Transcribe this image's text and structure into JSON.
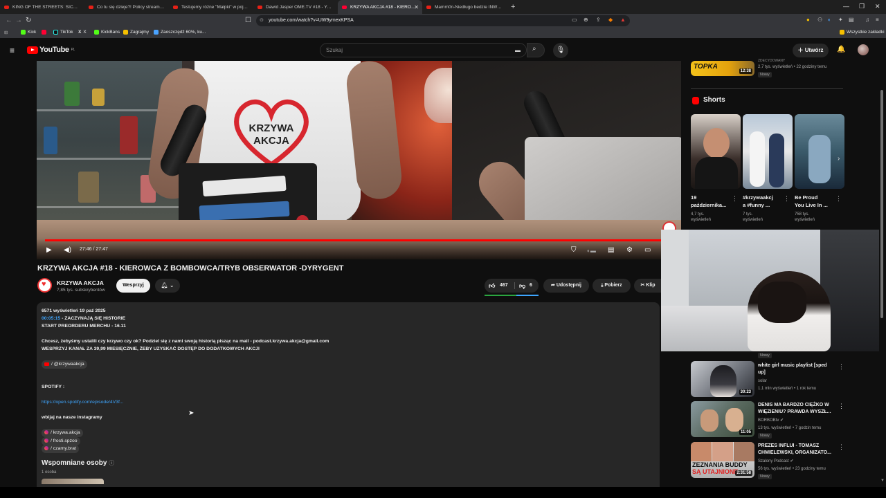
{
  "browser": {
    "tabs": [
      {
        "title": "KING OF THE STREETS: SICKO MODE"
      },
      {
        "title": "Co tu się dzieje?! Policy streamerzy -"
      },
      {
        "title": "Testujemy różne \"Małpki\" w pojedy..."
      },
      {
        "title": "Dawid Jasper OME.TV #18 - YouTube"
      },
      {
        "title": "KRZYWA AKCJA #18 - KIEROWC",
        "active": true
      },
      {
        "title": "Mamm0n-Niedługo bedzie INWIGIL..."
      }
    ],
    "url": "youtube.com/watch?v=UW9ymexKPSA",
    "bookmarks": [
      "Kick",
      "TikTok",
      "X",
      "KickBans",
      "Zagrajmy",
      "Zaoszczędź 60%, ku..."
    ],
    "all_bookmarks_label": "Wszystkie zakładki"
  },
  "yt_header": {
    "logo_text": "YouTube",
    "region": "PL",
    "search_placeholder": "Szukaj",
    "create_label": "Utwórz"
  },
  "player": {
    "time": "27:46 / 27:47",
    "progress_fraction": 0.999
  },
  "video": {
    "title": "KRZYWA AKCJA #18 - KIEROWCA Z BOMBOWCA/TRYB OBSERWATOR -DYRYGENT",
    "channel": "KRZYWA AKCJA",
    "subscribers": "7,85 tys. subskrybentów",
    "support_label": "Wesprzyj",
    "likes": "467",
    "dislikes": "6",
    "share_label": "Udostępnij",
    "download_label": "Pobierz",
    "clip_label": "Klip"
  },
  "description": {
    "stats": "6571 wyświetleń  19 paź 2025",
    "timestamp": "00:05:15",
    "line1_rest": " - ZACZYNAJĄ SIĘ HISTORIE",
    "line2": "START PREORDERU MERCHU - 16.11",
    "line3": "Chcesz, żebyśmy ustalili czy krzywo czy ok? Podziel się z nami swoją historią pisząc na mail - podcast.krzywa.akcja@gmail.com",
    "line4": "WESPRZYJ KANAŁ ZA 39,99 MIESIĘCZNIE, ŻEBY UZYSKAĆ DOSTĘP DO DODATKOWYCH AKCJI",
    "yt_handle": "/ @krzywaakcja",
    "spotify_label": "SPOTIFY :",
    "spotify_link": "https://open.spotify.com/episode/4V3f...",
    "instagram_label": "wbijaj na nasze instagramy",
    "instagrams": [
      "/ krzywa.akcja",
      "/ frosti.spzoo",
      "/ czarny.brat"
    ],
    "mentioned_title": "Wspomniane osoby",
    "mentioned_count": "1 osoba"
  },
  "sidebar": {
    "top_item": {
      "duration": "12:38",
      "meta": "2,7 tys. wyświetleń • 22 godziny temu",
      "badge": "Nowy",
      "channel_partial": "ZDECYDOWANY",
      "thumb_text": "TOPKA"
    },
    "shorts_label": "Shorts",
    "shorts": [
      {
        "title_l1": "19",
        "title_l2": "października...",
        "views_l1": "4,7 tys.",
        "views_l2": "wyświetleń"
      },
      {
        "title_l1": "#krzywaakcj",
        "title_l2": "a #funny ...",
        "views_l1": "7 tys.",
        "views_l2": "wyświetleń"
      },
      {
        "title_l1": "Be Proud",
        "title_l2": "You Live In ...",
        "views_l1": "758 tys.",
        "views_l2": "wyświetleń"
      }
    ],
    "videos": [
      {
        "badge": "Nowy",
        "title_l1": "white girl music playlist [sped",
        "title_l2": "up]",
        "channel": "solar",
        "meta": "1,1 mln wyświetleń • 1 rok temu",
        "duration": "30:23"
      },
      {
        "title_l1": "DENIS MA BARDZO CIĘŻKO W",
        "title_l2": "WIĘZIENIU? PRAWDA WYSZŁ...",
        "channel": "BORBOBtv",
        "meta": "13 tys. wyświetleń • 7 godzin temu",
        "badge": "Nowy",
        "duration": "11:05"
      },
      {
        "title_l1": "PREZES INFLUI - TOMASZ",
        "title_l2": "CHMIELEWSKI, ORGANIZATO...",
        "channel": "Szalony Podcast",
        "meta": "56 tys. wyświetleń • 23 godziny temu",
        "badge": "Nowy",
        "duration": "2:31:58",
        "thumb_text_l1": "ZEZNANIA BUDDY",
        "thumb_text_l2": "SĄ UTAJNIONE"
      }
    ]
  },
  "colors": {
    "accent_red": "#ff0000",
    "link_blue": "#3ea6ff",
    "bg": "#0f0f0f"
  }
}
